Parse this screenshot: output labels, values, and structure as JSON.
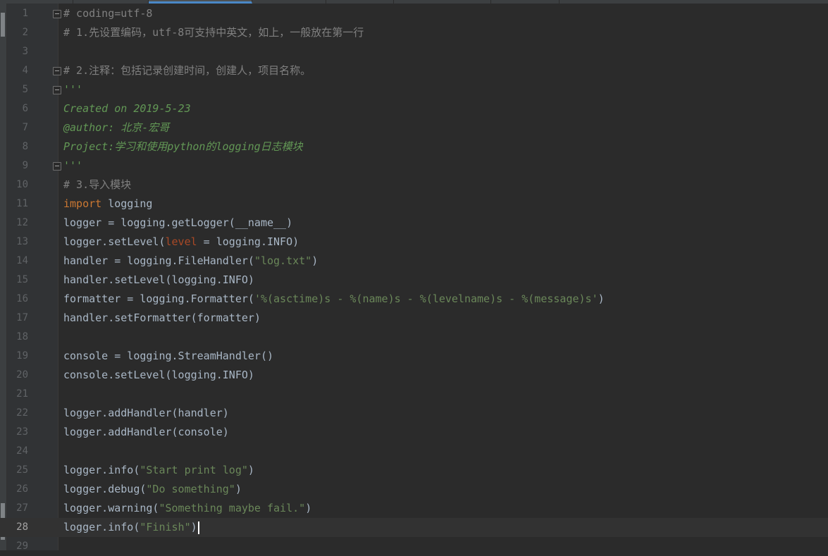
{
  "editor": {
    "lines": [
      {
        "n": "1",
        "fold": true,
        "t": [
          {
            "c": "comment",
            "s": "# coding=utf-8"
          }
        ]
      },
      {
        "n": "2",
        "t": [
          {
            "c": "comment",
            "s": "# 1.先设置编码，utf-8可支持中英文，如上，一般放在第一行"
          }
        ]
      },
      {
        "n": "3",
        "t": []
      },
      {
        "n": "4",
        "fold": true,
        "t": [
          {
            "c": "comment",
            "s": "# 2.注释：包括记录创建时间，创建人，项目名称。"
          }
        ]
      },
      {
        "n": "5",
        "fold": true,
        "t": [
          {
            "c": "doc",
            "s": "'''"
          }
        ]
      },
      {
        "n": "6",
        "t": [
          {
            "c": "doc",
            "s": "Created on 2019-5-23"
          }
        ]
      },
      {
        "n": "7",
        "t": [
          {
            "c": "doc",
            "s": "@author: 北京-宏哥"
          }
        ]
      },
      {
        "n": "8",
        "t": [
          {
            "c": "doc",
            "s": "Project:学习和使用python的logging日志模块"
          }
        ]
      },
      {
        "n": "9",
        "fold": true,
        "t": [
          {
            "c": "doc",
            "s": "'''"
          }
        ]
      },
      {
        "n": "10",
        "t": [
          {
            "c": "comment",
            "s": "# 3.导入模块"
          }
        ]
      },
      {
        "n": "11",
        "t": [
          {
            "c": "kw",
            "s": "import"
          },
          {
            "c": "",
            "s": " logging"
          }
        ]
      },
      {
        "n": "12",
        "t": [
          {
            "c": "",
            "s": "logger = logging.getLogger(__name__)"
          }
        ]
      },
      {
        "n": "13",
        "t": [
          {
            "c": "",
            "s": "logger.setLevel("
          },
          {
            "c": "param",
            "s": "level"
          },
          {
            "c": "",
            "s": " = logging.INFO)"
          }
        ]
      },
      {
        "n": "14",
        "t": [
          {
            "c": "",
            "s": "handler = logging.FileHandler("
          },
          {
            "c": "str",
            "s": "\"log.txt\""
          },
          {
            "c": "",
            "s": ")"
          }
        ]
      },
      {
        "n": "15",
        "t": [
          {
            "c": "",
            "s": "handler.setLevel(logging.INFO)"
          }
        ]
      },
      {
        "n": "16",
        "t": [
          {
            "c": "",
            "s": "formatter = logging.Formatter("
          },
          {
            "c": "str",
            "s": "'%(asctime)s - %(name)s - %(levelname)s - %(message)s'"
          },
          {
            "c": "",
            "s": ")"
          }
        ]
      },
      {
        "n": "17",
        "t": [
          {
            "c": "",
            "s": "handler.setFormatter(formatter)"
          }
        ]
      },
      {
        "n": "18",
        "t": []
      },
      {
        "n": "19",
        "t": [
          {
            "c": "",
            "s": "console = logging.StreamHandler()"
          }
        ]
      },
      {
        "n": "20",
        "t": [
          {
            "c": "",
            "s": "console.setLevel(logging.INFO)"
          }
        ]
      },
      {
        "n": "21",
        "t": []
      },
      {
        "n": "22",
        "t": [
          {
            "c": "",
            "s": "logger.addHandler(handler)"
          }
        ]
      },
      {
        "n": "23",
        "t": [
          {
            "c": "",
            "s": "logger.addHandler(console)"
          }
        ]
      },
      {
        "n": "24",
        "t": []
      },
      {
        "n": "25",
        "t": [
          {
            "c": "",
            "s": "logger.info("
          },
          {
            "c": "str",
            "s": "\"Start print log\""
          },
          {
            "c": "",
            "s": ")"
          }
        ]
      },
      {
        "n": "26",
        "t": [
          {
            "c": "",
            "s": "logger.debug("
          },
          {
            "c": "str",
            "s": "\"Do something\""
          },
          {
            "c": "",
            "s": ")"
          }
        ]
      },
      {
        "n": "27",
        "t": [
          {
            "c": "",
            "s": "logger.warning("
          },
          {
            "c": "str",
            "s": "\"Something maybe fail.\""
          },
          {
            "c": "",
            "s": ")"
          }
        ]
      },
      {
        "n": "28",
        "current": true,
        "cursor": true,
        "t": [
          {
            "c": "",
            "s": "logger.info("
          },
          {
            "c": "str",
            "s": "\"Finish\""
          },
          {
            "c": "",
            "s": ")"
          }
        ]
      },
      {
        "n": "29",
        "t": []
      }
    ]
  },
  "theme": {
    "background": "#2b2b2b",
    "gutter": "#313335",
    "text": "#a9b7c6",
    "comment": "#808080",
    "docstring": "#629755",
    "keyword": "#cc7832",
    "string": "#6a8759",
    "parameter": "#aa4926",
    "current_line": "#323232"
  }
}
